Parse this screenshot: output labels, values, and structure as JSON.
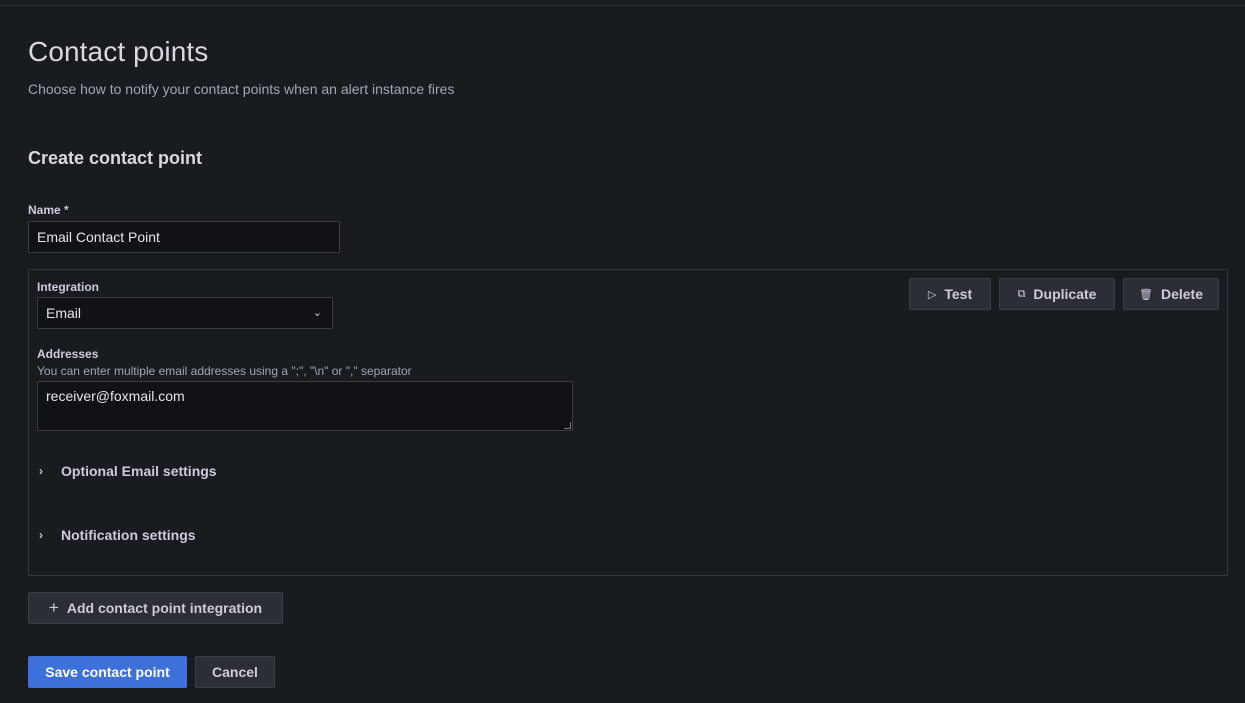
{
  "page": {
    "title": "Contact points",
    "subtitle": "Choose how to notify your contact points when an alert instance fires"
  },
  "form": {
    "section_title": "Create contact point",
    "name_label": "Name *",
    "name_value": "Email Contact Point",
    "integration": {
      "label": "Integration",
      "selected": "Email",
      "addresses_label": "Addresses",
      "addresses_help": "You can enter multiple email addresses using a \";\", \"\\n\" or \",\" separator",
      "addresses_value": "receiver@foxmail.com",
      "optional_settings_label": "Optional Email settings",
      "notification_settings_label": "Notification settings",
      "test_label": "Test",
      "duplicate_label": "Duplicate",
      "delete_label": "Delete"
    },
    "add_integration_label": "Add contact point integration",
    "save_label": "Save contact point",
    "cancel_label": "Cancel"
  },
  "icons": {
    "test": "play-icon",
    "duplicate": "copy-icon",
    "delete": "trash-icon",
    "add": "plus-icon",
    "select": "chevron-down-icon",
    "collapse": "chevron-right-icon"
  },
  "colors": {
    "background": "#181b1f",
    "primary_button": "#3d71d9"
  }
}
